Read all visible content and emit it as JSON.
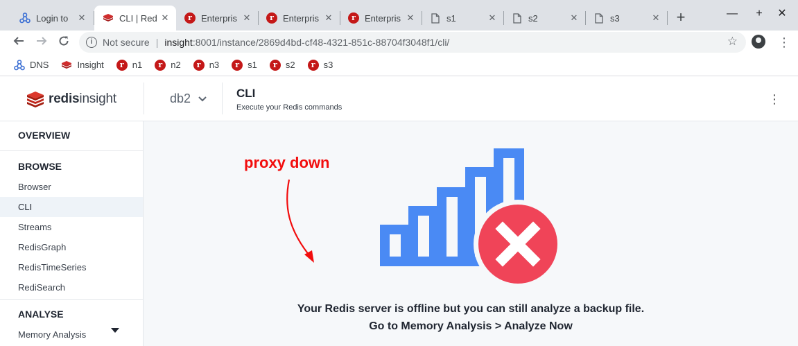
{
  "browser": {
    "tabs": [
      {
        "title": "Login to",
        "favicon": "dns-icon",
        "active": false
      },
      {
        "title": "CLI | Red",
        "favicon": "redis-insight-icon",
        "active": true
      },
      {
        "title": "Enterpris",
        "favicon": "redis-r-icon",
        "active": false
      },
      {
        "title": "Enterpris",
        "favicon": "redis-r-icon",
        "active": false
      },
      {
        "title": "Enterpris",
        "favicon": "redis-r-icon",
        "active": false
      },
      {
        "title": "s1",
        "favicon": "document-icon",
        "active": false
      },
      {
        "title": "s2",
        "favicon": "document-icon",
        "active": false
      },
      {
        "title": "s3",
        "favicon": "document-icon",
        "active": false
      }
    ],
    "new_tab": "+",
    "controls": {
      "minimize": "—",
      "maximize": "+",
      "close": "✕"
    },
    "address": {
      "security": "Not secure",
      "host": "insight",
      "path": ":8001/instance/2869d4bd-cf48-4321-851c-88704f3048f1/cli/"
    },
    "bookmarks": [
      {
        "label": "DNS",
        "icon": "dns-icon"
      },
      {
        "label": "Insight",
        "icon": "redis-insight-icon"
      },
      {
        "label": "n1",
        "icon": "redis-r-icon"
      },
      {
        "label": "n2",
        "icon": "redis-r-icon"
      },
      {
        "label": "n3",
        "icon": "redis-r-icon"
      },
      {
        "label": "s1",
        "icon": "redis-r-icon"
      },
      {
        "label": "s2",
        "icon": "redis-r-icon"
      },
      {
        "label": "s3",
        "icon": "redis-r-icon"
      }
    ]
  },
  "app": {
    "logo": {
      "bold": "redis",
      "light": "insight"
    },
    "db_selector": "db2",
    "page_title": "CLI",
    "page_subtitle": "Execute your Redis commands"
  },
  "sidebar": {
    "overview": "OVERVIEW",
    "browse_title": "BROWSE",
    "browse_items": [
      {
        "label": "Browser",
        "active": false
      },
      {
        "label": "CLI",
        "active": true
      },
      {
        "label": "Streams",
        "active": false
      },
      {
        "label": "RedisGraph",
        "active": false
      },
      {
        "label": "RedisTimeSeries",
        "active": false
      },
      {
        "label": "RediSearch",
        "active": false
      }
    ],
    "analyse_title": "ANALYSE",
    "analyse_items": [
      {
        "label": "Memory Analysis"
      }
    ]
  },
  "main": {
    "annotation": "proxy down",
    "offline_line1": "Your Redis server is offline but you can still analyze a backup file.",
    "offline_line2": "Go to Memory Analysis > Analyze Now"
  },
  "colors": {
    "annotation_red": "#f20d0d",
    "signal_blue": "#4a8af4",
    "error_red": "#f04458",
    "redis_red": "#c41818"
  }
}
